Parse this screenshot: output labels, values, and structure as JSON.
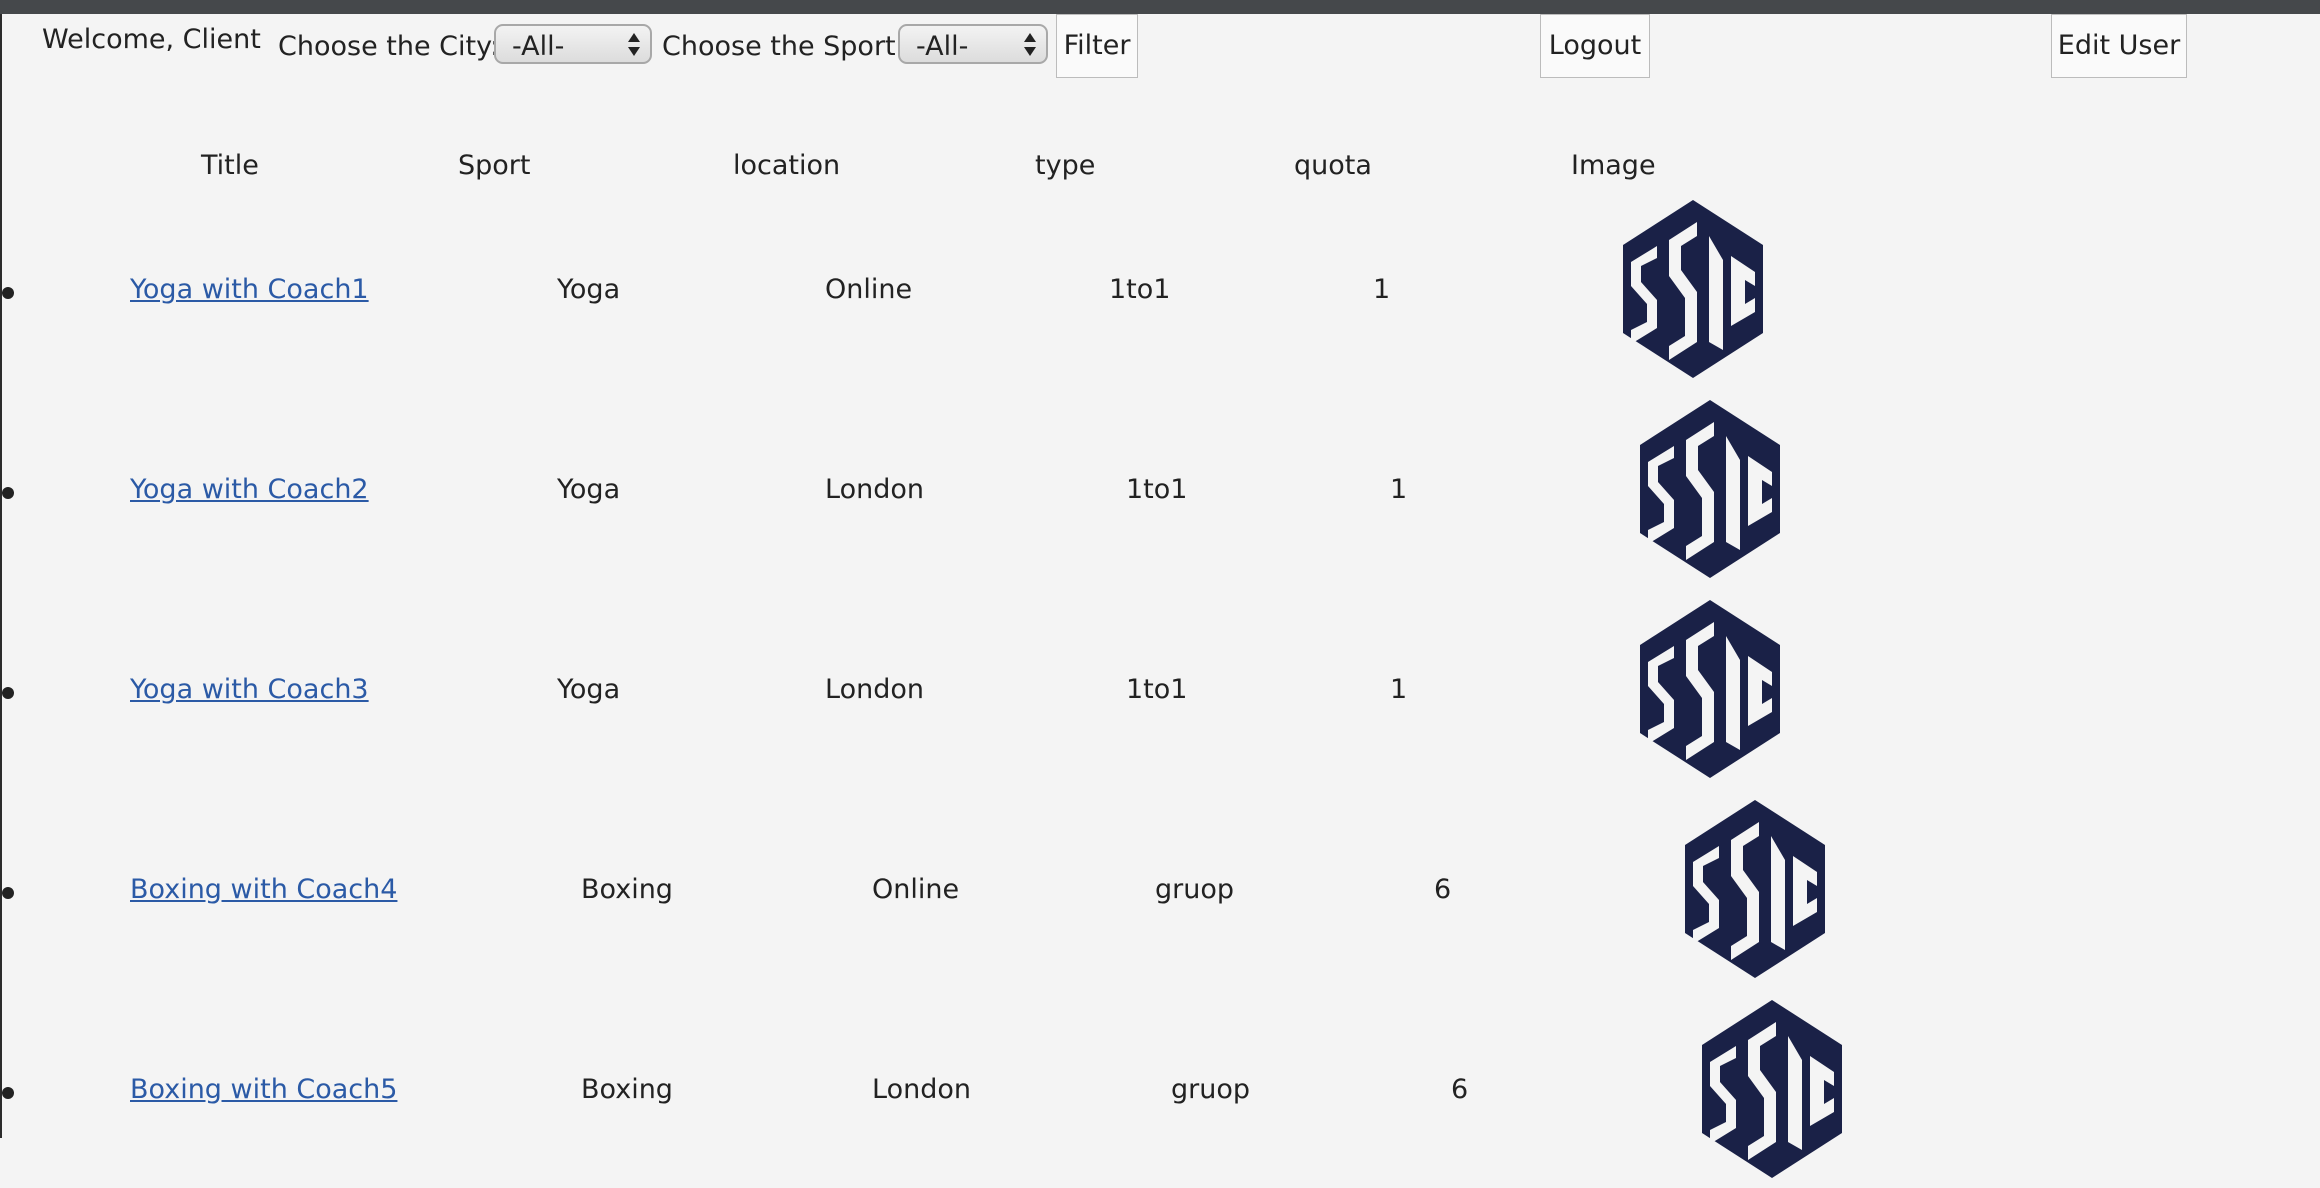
{
  "header": {
    "welcome": "Welcome, Client",
    "city_label": "Choose the City:",
    "city_value": "-All-",
    "sport_label": "Choose the Sport:",
    "sport_value": "-All-",
    "filter_label": "Filter",
    "logout_label": "Logout",
    "edit_user_label": "Edit User"
  },
  "table": {
    "columns": [
      "Title",
      "Sport",
      "location",
      "type",
      "quota",
      "Image"
    ],
    "rows": [
      {
        "title": "Yoga with Coach1",
        "sport": "Yoga",
        "location": "Online",
        "type": "1to1",
        "quota": "1",
        "image": "ssc-logo"
      },
      {
        "title": "Yoga with Coach2",
        "sport": "Yoga",
        "location": "London",
        "type": "1to1",
        "quota": "1",
        "image": "ssc-logo"
      },
      {
        "title": "Yoga with Coach3",
        "sport": "Yoga",
        "location": "London",
        "type": "1to1",
        "quota": "1",
        "image": "ssc-logo"
      },
      {
        "title": "Boxing with Coach4",
        "sport": "Boxing",
        "location": "Online",
        "type": "gruop",
        "quota": "6",
        "image": "ssc-logo"
      },
      {
        "title": "Boxing with Coach5",
        "sport": "Boxing",
        "location": "London",
        "type": "gruop",
        "quota": "6",
        "image": "ssc-logo"
      }
    ]
  },
  "colors": {
    "link": "#2b5aa6",
    "logo": "#1a2147",
    "background": "#f4f4f4",
    "topbar": "#45484b"
  },
  "logo_text": "SSC"
}
